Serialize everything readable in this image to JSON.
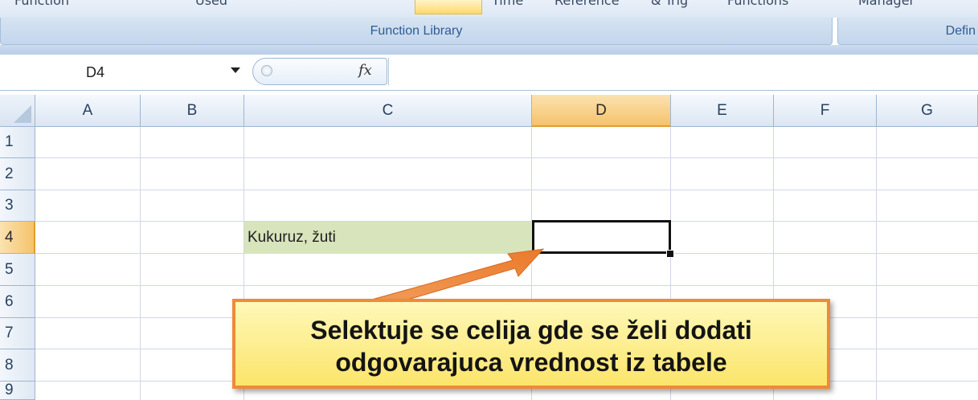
{
  "ribbon": {
    "top_cut_labels": [
      "Function",
      "Used",
      "Time",
      "Reference",
      "& Trig",
      "Functions",
      "Manager"
    ],
    "group_function_library": "Function Library",
    "group_defined_names": "Defin"
  },
  "formula_bar": {
    "name_box": "D4",
    "fx_label": "fx",
    "formula": ""
  },
  "columns": [
    "A",
    "B",
    "C",
    "D",
    "E",
    "F",
    "G"
  ],
  "rows": [
    "1",
    "2",
    "3",
    "4",
    "5",
    "6",
    "7",
    "8",
    "9"
  ],
  "selected_cell": "D4",
  "cells": {
    "C4": "Kukuruz, žuti",
    "D4": ""
  },
  "callout": {
    "line1": "Selektuje se celija gde se želi dodati",
    "line2": "odgovarajuca vrednost iz tabele"
  },
  "colors": {
    "selection_header": "#f5c36c",
    "cell_c4_fill": "#d8e4bc",
    "callout_fill": "#fbe56b",
    "callout_border": "#ef8a38"
  }
}
